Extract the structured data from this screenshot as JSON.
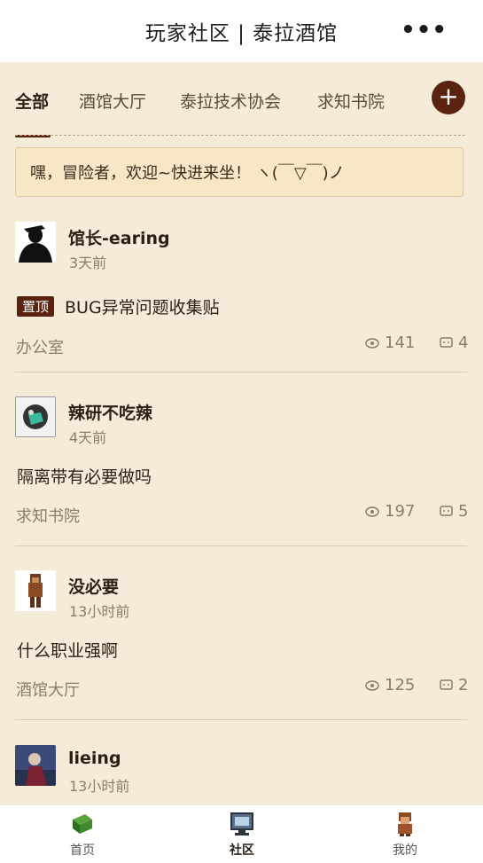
{
  "header": {
    "title": "玩家社区 | 泰拉酒馆",
    "more_icon": "more-dots-icon"
  },
  "tabs": [
    {
      "label": "全部",
      "active": true
    },
    {
      "label": "酒馆大厅"
    },
    {
      "label": "泰拉技术协会"
    },
    {
      "label": "求知书院"
    }
  ],
  "add_button": {
    "label": "+"
  },
  "welcome": "嘿，冒险者，欢迎~快进来坐！ ヽ(￣▽￣)ノ",
  "posts": [
    {
      "author": "馆长-earing",
      "time": "3天前",
      "pinned": true,
      "pin_label": "置顶",
      "title": "BUG异常问题收集贴",
      "forum": "办公室",
      "views": "141",
      "comments": "4"
    },
    {
      "author": "辣研不吃辣",
      "time": "4天前",
      "title": "隔离带有必要做吗",
      "forum": "求知书院",
      "views": "197",
      "comments": "5"
    },
    {
      "author": "没必要",
      "time": "13小时前",
      "title": "什么职业强啊",
      "forum": "酒馆大厅",
      "views": "125",
      "comments": "2"
    },
    {
      "author": "lieing",
      "time": "13小时前"
    }
  ],
  "bottom_nav": [
    {
      "label": "首页",
      "icon": "book-icon"
    },
    {
      "label": "社区",
      "icon": "computer-icon",
      "active": true
    },
    {
      "label": "我的",
      "icon": "character-icon"
    }
  ],
  "colors": {
    "accent": "#5a2310",
    "background": "#f4ecd9",
    "banner": "#f7e7c7"
  }
}
